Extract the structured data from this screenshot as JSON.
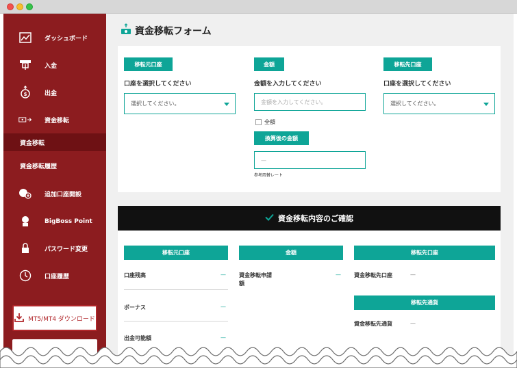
{
  "sidebar": {
    "items": [
      {
        "label": "ダッシュボード",
        "icon": "dashboard-chart-icon"
      },
      {
        "label": "入金",
        "icon": "atm-deposit-icon"
      },
      {
        "label": "出金",
        "icon": "money-bag-withdraw-icon"
      },
      {
        "label": "資金移転",
        "icon": "money-transfer-icon"
      },
      {
        "label": "追加口座開設",
        "icon": "add-account-icon"
      },
      {
        "label": "BigBoss Point",
        "icon": "medal-icon"
      },
      {
        "label": "パスワード変更",
        "icon": "lock-icon"
      },
      {
        "label": "口座履歴",
        "icon": "clock-icon"
      }
    ],
    "sub_items": [
      {
        "label": "資金移転",
        "active": true
      },
      {
        "label": "資金移転履歴",
        "active": false
      }
    ],
    "download_label": "MT5/MT4 ダウンロード"
  },
  "form": {
    "title": "資金移転フォーム",
    "source": {
      "tag": "移転元口座",
      "label": "口座を選択してください",
      "selected": "選択してください。"
    },
    "amount": {
      "tag": "金額",
      "label": "金額を入力してください",
      "placeholder": "金額を入力してください。",
      "full_amount_label": "全額",
      "converted_tag": "換算後の金額",
      "converted_value": "—",
      "rate_note": "参考両替レート"
    },
    "destination": {
      "tag": "移転先口座",
      "label": "口座を選択してください",
      "selected": "選択してください。"
    }
  },
  "confirm": {
    "title": "資金移転内容のご確認",
    "col1": {
      "header": "移転元口座",
      "rows": [
        {
          "label": "口座残高",
          "value": "—"
        },
        {
          "label": "ボーナス",
          "value": "—"
        },
        {
          "label": "出金可能額",
          "value": "—"
        }
      ]
    },
    "col2": {
      "header": "金額",
      "rows": [
        {
          "label_line1": "資金移転申請",
          "label_line2": "額",
          "value": "—"
        }
      ]
    },
    "col3": {
      "header": "移転先口座",
      "rows": [
        {
          "label": "資金移転先口座",
          "value": "—"
        }
      ],
      "header2": "移転先通貨",
      "rows2": [
        {
          "label": "資金移転先通貨",
          "value": "—"
        }
      ]
    }
  },
  "colors": {
    "sidebar": "#8c1c1f",
    "sidebar_active": "#6e1114",
    "accent": "#0ea597",
    "confirm_bar": "#111111"
  }
}
